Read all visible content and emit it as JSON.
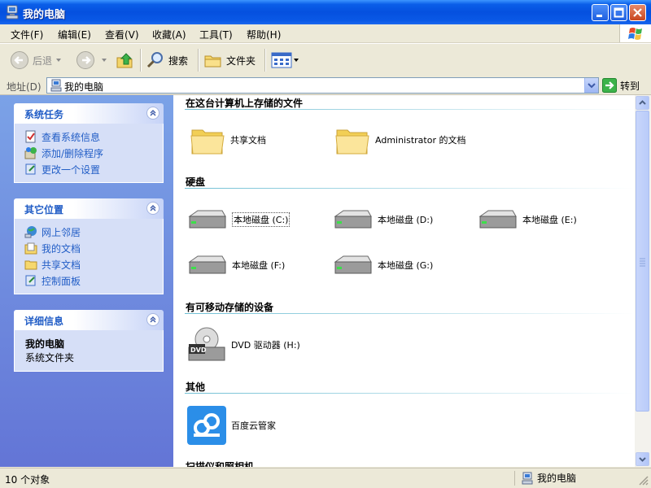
{
  "window": {
    "title": "我的电脑"
  },
  "menu": [
    {
      "label": "文件(F)"
    },
    {
      "label": "编辑(E)"
    },
    {
      "label": "查看(V)"
    },
    {
      "label": "收藏(A)"
    },
    {
      "label": "工具(T)"
    },
    {
      "label": "帮助(H)"
    }
  ],
  "toolbar": {
    "back": "后退",
    "search": "搜索",
    "folders": "文件夹"
  },
  "address": {
    "label": "地址(D)",
    "value": "我的电脑",
    "go": "转到"
  },
  "tasks": {
    "system": {
      "title": "系统任务",
      "items": [
        "查看系统信息",
        "添加/删除程序",
        "更改一个设置"
      ]
    },
    "places": {
      "title": "其它位置",
      "items": [
        "网上邻居",
        "我的文档",
        "共享文档",
        "控制面板"
      ]
    },
    "details": {
      "title": "详细信息",
      "name": "我的电脑",
      "desc": "系统文件夹"
    }
  },
  "content": {
    "groups": [
      {
        "title": "在这台计算机上存储的文件"
      },
      {
        "title": "硬盘"
      },
      {
        "title": "有可移动存储的设备"
      },
      {
        "title": "其他"
      },
      {
        "title": "扫描仪和照相机"
      }
    ],
    "files": [
      "共享文档",
      "Administrator 的文档"
    ],
    "disks": [
      "本地磁盘 (C:)",
      "本地磁盘 (D:)",
      "本地磁盘 (E:)",
      "本地磁盘 (F:)",
      "本地磁盘 (G:)"
    ],
    "removable": [
      "DVD 驱动器 (H:)"
    ],
    "other": [
      "百度云管家"
    ]
  },
  "status": {
    "count": "10 个对象",
    "location": "我的电脑"
  },
  "colors": {
    "titlebar": "#0550df",
    "taskpane": "#6e8ee0",
    "link": "#215dc6"
  }
}
